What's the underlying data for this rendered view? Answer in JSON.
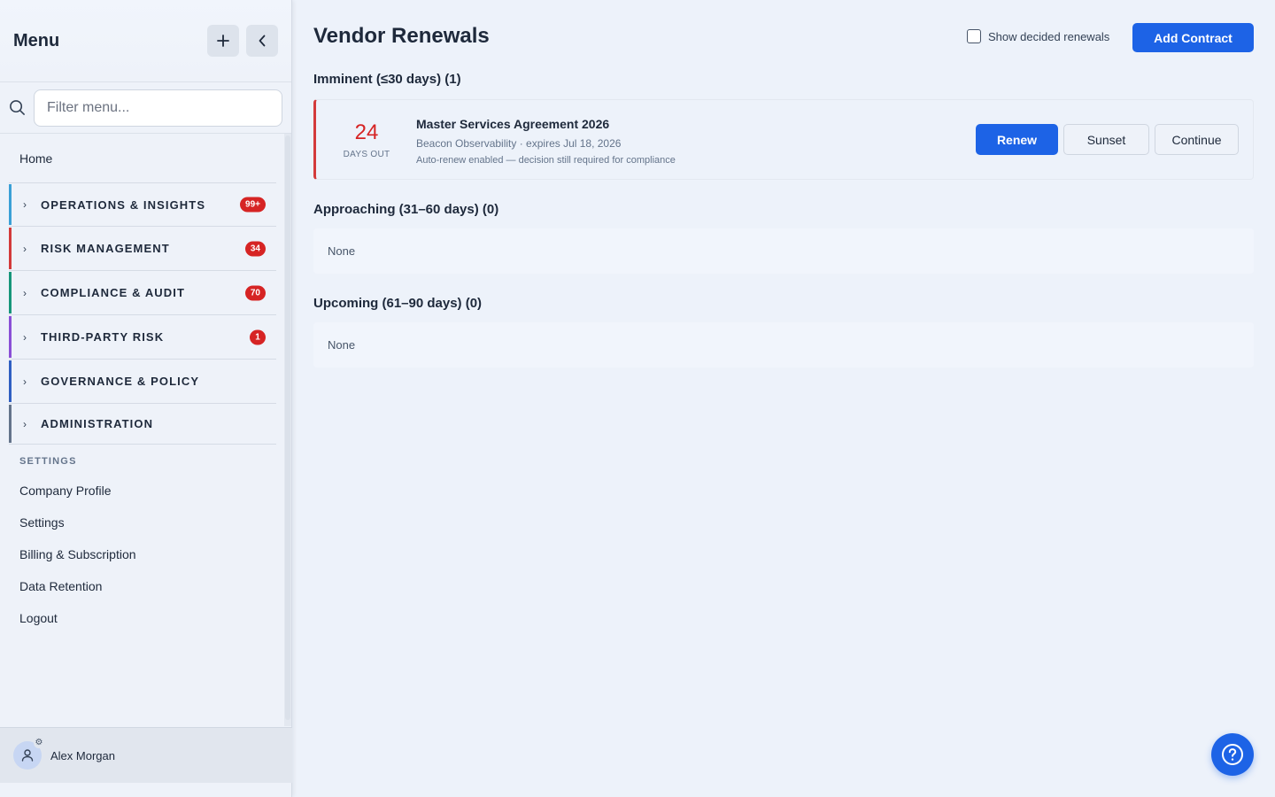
{
  "sidebar": {
    "title": "Menu",
    "add_icon": "plus-icon",
    "collapse_icon": "chevron-left-icon",
    "search_placeholder": "Filter menu...",
    "home_label": "Home",
    "sections": [
      {
        "label": "OPERATIONS & INSIGHTS",
        "badge": "99+",
        "color": "#3aa0d6"
      },
      {
        "label": "RISK MANAGEMENT",
        "badge": "34",
        "color": "#d33a3a"
      },
      {
        "label": "COMPLIANCE & AUDIT",
        "badge": "70",
        "color": "#16967a"
      },
      {
        "label": "THIRD-PARTY RISK",
        "badge": "1",
        "color": "#8a4fd6"
      },
      {
        "label": "GOVERNANCE & POLICY",
        "badge": "",
        "color": "#2f5fc2"
      },
      {
        "label": "ADMINISTRATION",
        "badge": "",
        "color": "#64748b"
      }
    ],
    "settings_heading": "SETTINGS",
    "settings_items": [
      "Company Profile",
      "Settings",
      "Billing & Subscription",
      "Data Retention",
      "Logout"
    ],
    "user_name": "Alex Morgan"
  },
  "header": {
    "title": "Vendor Renewals",
    "toggle_label": "Show decided renewals",
    "toggle_checked": false,
    "add_button": "Add Contract"
  },
  "groups": {
    "imminent": {
      "title": "Imminent (≤30 days) (1)",
      "items": [
        {
          "days": "24",
          "days_label": "DAYS OUT",
          "title": "Master Services Agreement 2026",
          "meta": "Beacon Observability · expires Jul 18, 2026",
          "note": "Auto-renew enabled — decision still required for compliance",
          "actions": [
            "Renew",
            "Sunset",
            "Continue"
          ]
        }
      ]
    },
    "approaching": {
      "title": "Approaching (31–60 days) (0)",
      "empty_text": "None"
    },
    "upcoming": {
      "title": "Upcoming (61–90 days) (0)",
      "empty_text": "None"
    }
  },
  "colors": {
    "accent": "#1d63e6",
    "danger": "#d62424",
    "background": "#edf2fa"
  },
  "help_icon": "question-circle-icon"
}
